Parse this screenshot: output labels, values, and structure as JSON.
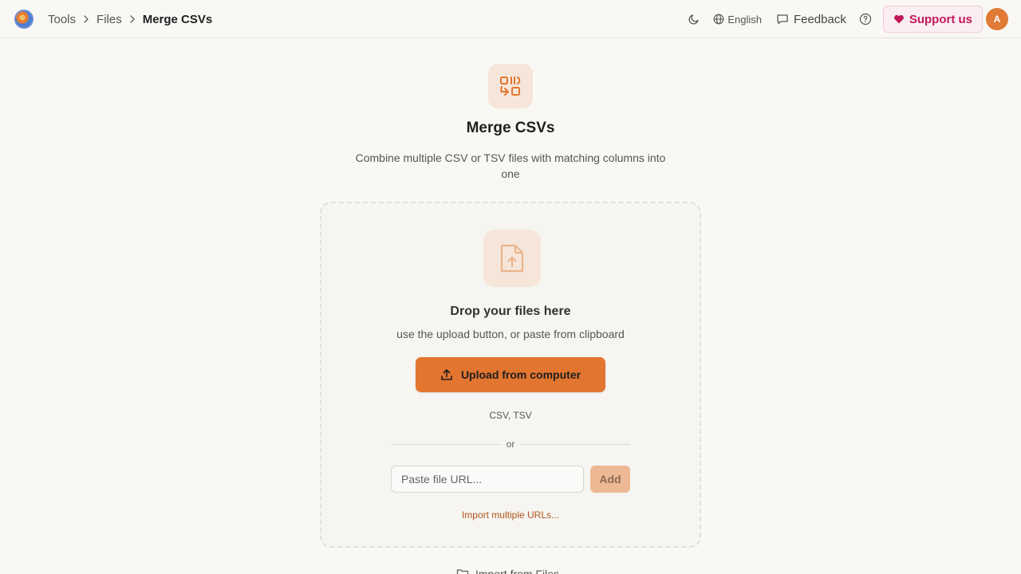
{
  "header": {
    "breadcrumbs": [
      "Tools",
      "Files",
      "Merge CSVs"
    ],
    "language": "English",
    "feedback_label": "Feedback",
    "support_label": "Support us",
    "avatar_initial": "A"
  },
  "main": {
    "title": "Merge CSVs",
    "subtitle": "Combine multiple CSV or TSV files with matching columns into one",
    "dropzone": {
      "title": "Drop your files here",
      "subtitle": "use the upload button, or paste from clipboard",
      "upload_label": "Upload from computer",
      "formats": "CSV, TSV",
      "or_label": "or",
      "url_placeholder": "Paste file URL...",
      "add_label": "Add",
      "import_multiple_label": "Import multiple URLs..."
    },
    "import_files_label": "Import from Files"
  },
  "colors": {
    "accent": "#e2752f",
    "support": "#c2185b",
    "background": "#f9f8f5"
  },
  "icons": [
    "logo",
    "chevron-right-icon",
    "moon-icon",
    "globe-icon",
    "message-square-icon",
    "help-circle-icon",
    "heart-icon",
    "merge-icon",
    "file-upload-icon",
    "upload-icon",
    "folder-icon"
  ]
}
